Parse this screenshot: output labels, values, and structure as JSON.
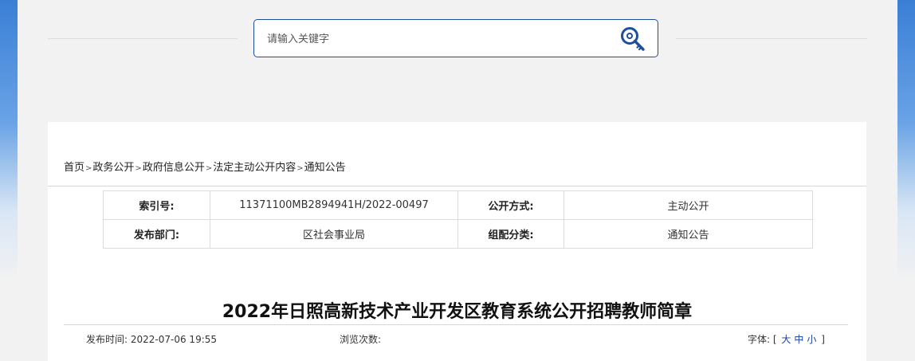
{
  "search": {
    "placeholder": "请输入关键字"
  },
  "breadcrumb": [
    {
      "label": "首页"
    },
    {
      "label": "政务公开"
    },
    {
      "label": "政府信息公开"
    },
    {
      "label": "法定主动公开内容"
    },
    {
      "label": "通知公告"
    }
  ],
  "meta": {
    "index_label": "索引号:",
    "index_value": "11371100MB2894941H/2022-00497",
    "open_method_label": "公开方式:",
    "open_method_value": "主动公开",
    "department_label": "发布部门:",
    "department_value": "区社会事业局",
    "category_label": "组配分类:",
    "category_value": "通知公告"
  },
  "article": {
    "title": "2022年日照高新技术产业开发区教育系统公开招聘教师简章",
    "publish_label": "发布时间:",
    "publish_time": "2022-07-06 19:55",
    "views_label": "浏览次数:",
    "font_label": "字体:",
    "font_open": "[",
    "font_large": "大",
    "font_medium": "中",
    "font_small": "小",
    "font_close": "]"
  },
  "colors": {
    "accent": "#1f4e9c",
    "link": "#1a3fa8",
    "background": "#f2f2f2"
  },
  "icons": {
    "search": "search-key-icon"
  }
}
